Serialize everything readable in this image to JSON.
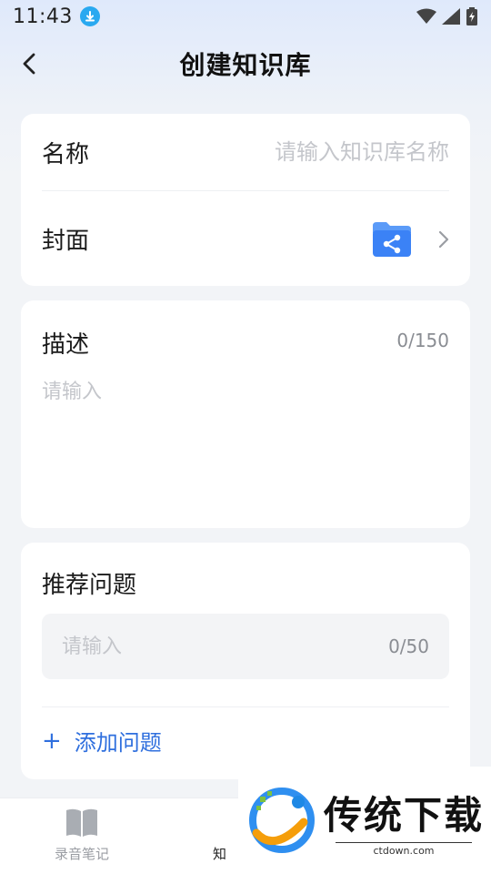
{
  "status_bar": {
    "time": "11:43"
  },
  "nav": {
    "title": "创建知识库"
  },
  "form": {
    "name_label": "名称",
    "name_placeholder": "请输入知识库名称",
    "cover_label": "封面",
    "desc_label": "描述",
    "desc_count": "0/150",
    "desc_placeholder": "请输入",
    "rec_label": "推荐问题",
    "question_placeholder": "请输入",
    "question_count": "0/50",
    "add_question_label": "添加问题"
  },
  "tabbar": {
    "items": [
      {
        "label": "录音笔记"
      },
      {
        "label": "知"
      }
    ]
  },
  "watermark": {
    "title": "传统下载",
    "url": "ctdown.com"
  },
  "colors": {
    "accent": "#2f6fde",
    "folder": "#3b82f6",
    "placeholder": "#c4c6cb"
  }
}
